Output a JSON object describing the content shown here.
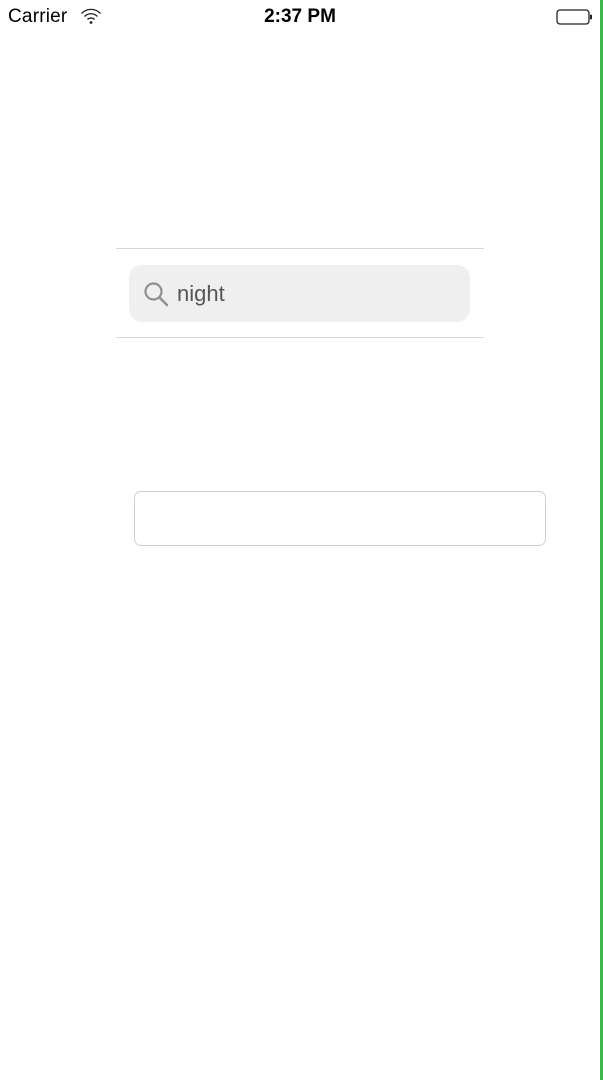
{
  "status_bar": {
    "carrier": "Carrier",
    "time": "2:37 PM",
    "wifi_icon": "wifi-icon",
    "battery_icon": "battery-icon"
  },
  "search": {
    "icon": "search-icon",
    "value": "night",
    "placeholder": ""
  },
  "text_field": {
    "value": "",
    "placeholder": ""
  },
  "colors": {
    "search_field_bg": "#efefef",
    "divider": "#d6d6d6",
    "right_edge": "#3fb54a"
  }
}
